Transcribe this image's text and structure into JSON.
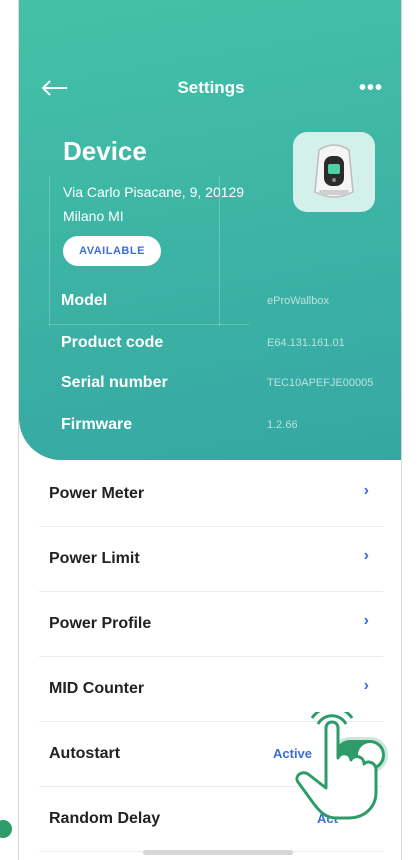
{
  "nav": {
    "title": "Settings",
    "back_icon": "back-arrow-icon",
    "more_icon": "more-dots-icon"
  },
  "device": {
    "title": "Device",
    "address_line1": "Via Carlo Pisacane, 9, 20129",
    "address_line2": "Milano MI",
    "status_badge": "AVAILABLE",
    "image_icon": "wallbox-charger-icon"
  },
  "info": [
    {
      "label": "Model",
      "value": "eProWallbox"
    },
    {
      "label": "Product code",
      "value": "E64.131.161.01"
    },
    {
      "label": "Serial number",
      "value": "TEC10APEFJE00005"
    },
    {
      "label": "Firmware",
      "value": "1.2.66"
    }
  ],
  "menu": [
    {
      "label": "Power Meter"
    },
    {
      "label": "Power Limit"
    },
    {
      "label": "Power Profile"
    },
    {
      "label": "MID Counter"
    },
    {
      "label": "Autostart",
      "status": "Active",
      "toggle_on": true
    },
    {
      "label": "Random Delay",
      "status": "Act"
    }
  ],
  "colors": {
    "header_teal": "#3cb3a5",
    "accent_blue": "#3b6fd6",
    "toggle_green": "#2e9c6a"
  }
}
